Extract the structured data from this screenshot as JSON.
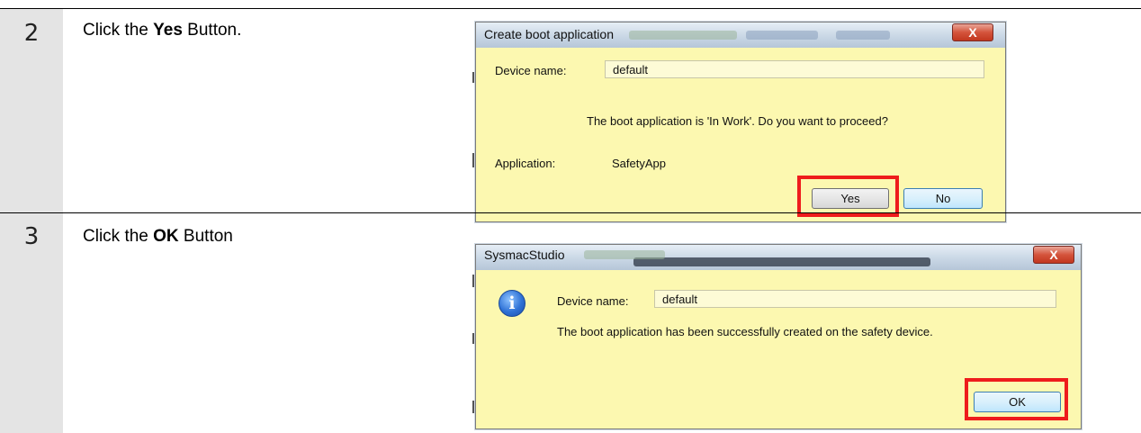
{
  "steps": [
    {
      "number": "2",
      "instruction_pre": "Click the ",
      "instruction_bold": "Yes",
      "instruction_post": " Button.",
      "dialog": {
        "title": "Create boot application",
        "device_label": "Device name:",
        "device_value": "default",
        "message": "The boot application is 'In Work'. Do you want to proceed?",
        "application_label": "Application:",
        "application_value": "SafetyApp",
        "yes_button": "Yes",
        "no_button": "No",
        "close_symbol": "X"
      }
    },
    {
      "number": "3",
      "instruction_pre": "Click the ",
      "instruction_bold": "OK",
      "instruction_post": " Button",
      "dialog": {
        "title": "SysmacStudio",
        "device_label": "Device name:",
        "device_value": "default",
        "message": "The boot application has been successfully created on the safety device.",
        "ok_button": "OK",
        "close_symbol": "X",
        "icon": "info-icon"
      }
    }
  ],
  "colors": {
    "dialog_bg": "#fcf8b0",
    "highlight": "#ee1c1c",
    "step_column": "#e4e4e4"
  }
}
